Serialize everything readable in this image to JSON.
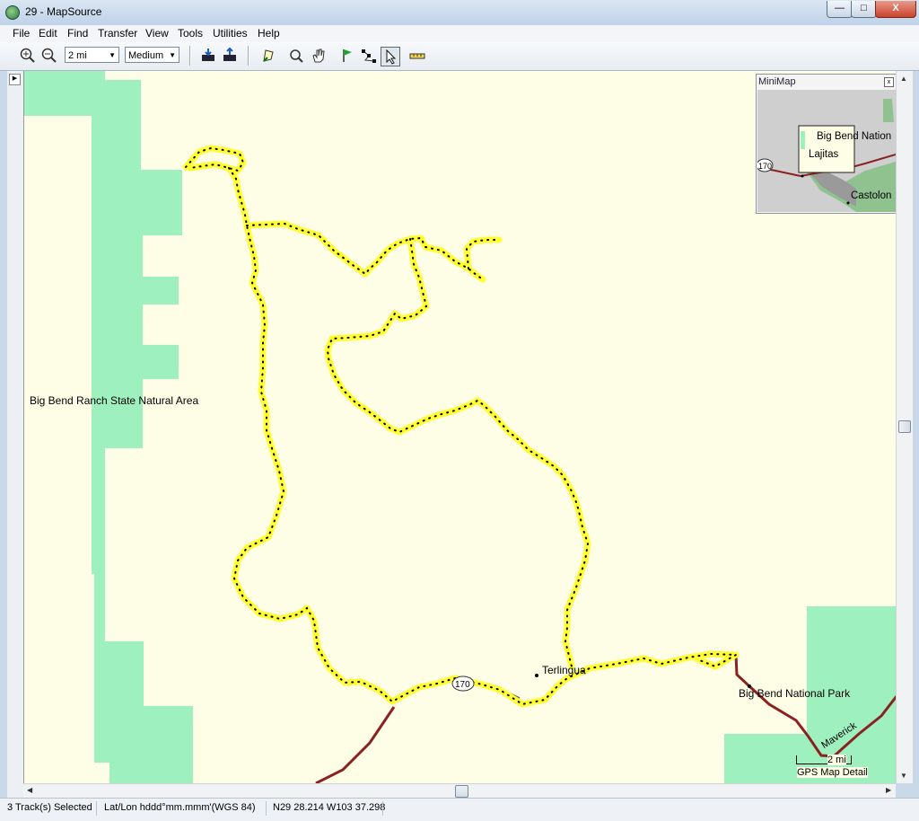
{
  "window": {
    "title": "29 - MapSource",
    "min_label": "—",
    "max_label": "□",
    "close_label": "X"
  },
  "menu": [
    {
      "id": "file",
      "label": "File"
    },
    {
      "id": "edit",
      "label": "Edit"
    },
    {
      "id": "find",
      "label": "Find"
    },
    {
      "id": "transfer",
      "label": "Transfer"
    },
    {
      "id": "view",
      "label": "View"
    },
    {
      "id": "tools",
      "label": "Tools"
    },
    {
      "id": "utilities",
      "label": "Utilities"
    },
    {
      "id": "help",
      "label": "Help"
    }
  ],
  "toolbar": {
    "zoom_scale": "2 mi",
    "detail_level": "Medium",
    "icons": [
      "zoom-in-icon",
      "zoom-out-icon",
      "receive-from-device-icon",
      "send-to-device-icon",
      "map-select-icon",
      "zoom-tool-icon",
      "hand-pan-icon",
      "waypoint-flag-icon",
      "route-tool-icon",
      "selection-arrow-icon",
      "measure-ruler-icon"
    ]
  },
  "map": {
    "labels": {
      "ranch": "Big Bend Ranch State Natural Area",
      "terlingua": "Terlingua",
      "park": "Big Bend National Park",
      "maverick": "Maverick",
      "route": "170"
    },
    "scale_label": "2 mi",
    "detail_label": "GPS Map Detail",
    "colors": {
      "background": "#fefde6",
      "park_green": "#9ff0bf",
      "track": "#ffff33",
      "road": "#8a2222"
    }
  },
  "minimap": {
    "title": "MiniMap",
    "close_label": "x",
    "labels": {
      "national": "Big Bend Nation",
      "lajitas": "Lajitas",
      "castolon": "Castolon",
      "route": "170"
    }
  },
  "status": {
    "selection": "3 Track(s) Selected",
    "format": "Lat/Lon hddd°mm.mmm'(WGS 84)",
    "coords": "N29 28.214 W103 37.298"
  }
}
